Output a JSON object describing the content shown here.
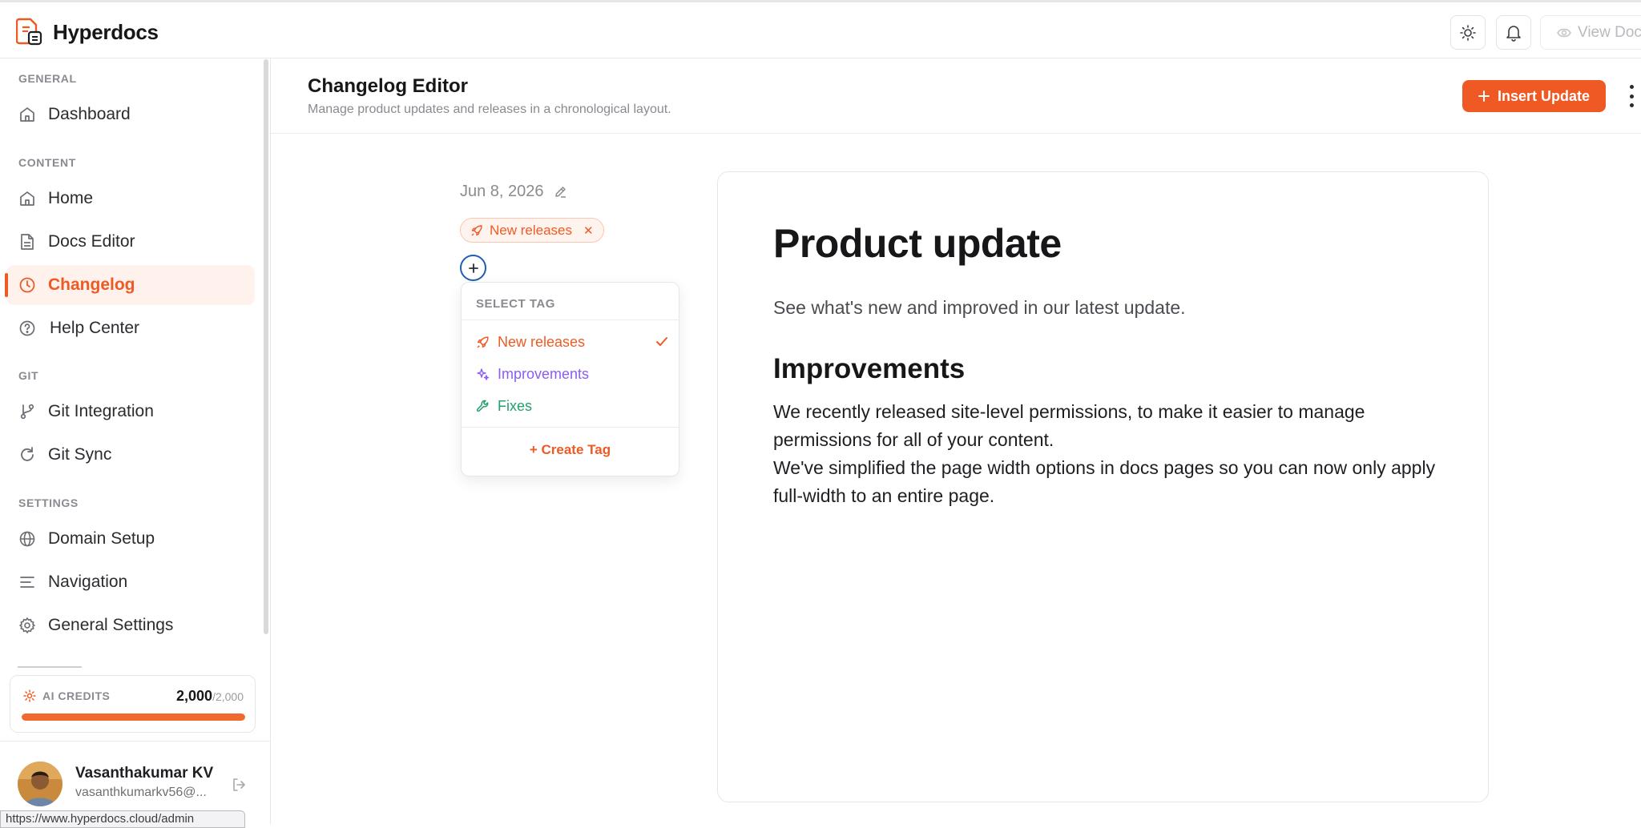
{
  "app": {
    "brand": "Hyperdocs",
    "view_doc_label": "View Doc"
  },
  "sidebar": {
    "sections": {
      "general": "GENERAL",
      "content": "CONTENT",
      "git": "GIT",
      "settings": "SETTINGS"
    },
    "items": [
      {
        "label": "Dashboard",
        "icon": "home-icon"
      },
      {
        "label": "Home",
        "icon": "home-icon"
      },
      {
        "label": "Docs Editor",
        "icon": "document-icon"
      },
      {
        "label": "Changelog",
        "icon": "clock-icon",
        "active": true
      },
      {
        "label": "Help Center",
        "icon": "help-circle-icon"
      },
      {
        "label": "Git Integration",
        "icon": "git-branch-icon"
      },
      {
        "label": "Git Sync",
        "icon": "refresh-icon"
      },
      {
        "label": "Domain Setup",
        "icon": "globe-icon"
      },
      {
        "label": "Navigation",
        "icon": "menu-lines-icon"
      },
      {
        "label": "General Settings",
        "icon": "gear-icon"
      }
    ],
    "credits": {
      "label": "AI CREDITS",
      "used": "2,000",
      "total": "/2,000",
      "progress": 1.0
    },
    "user": {
      "name": "Vasanthakumar KV",
      "email": "vasanthkumarkv56@..."
    },
    "status_url": "https://www.hyperdocs.cloud/admin"
  },
  "page": {
    "title": "Changelog Editor",
    "subtitle": "Manage product updates and releases in a chronological layout.",
    "insert_button": "Insert Update"
  },
  "entry": {
    "date": "Jun 8, 2026",
    "selected_tag": "New releases",
    "dropdown": {
      "header": "SELECT TAG",
      "options": [
        {
          "label": "New releases",
          "color": "#ef5a24",
          "checked": true
        },
        {
          "label": "Improvements",
          "color": "#8b5cf6",
          "checked": false
        },
        {
          "label": "Fixes",
          "color": "#22a06b",
          "checked": false
        }
      ],
      "create_label": "+ Create Tag"
    }
  },
  "editor": {
    "heading": "Product update",
    "lead": "See what's new and improved in our latest update.",
    "subheading": "Improvements",
    "paragraph_1": "We recently released site-level permissions, to make it easier to manage permissions for all of your content.",
    "paragraph_2": "We've simplified the page width options in docs pages so you can now only apply full-width to an entire page."
  },
  "colors": {
    "accent": "#ef5a24",
    "focus_ring": "#1b5fb6"
  }
}
